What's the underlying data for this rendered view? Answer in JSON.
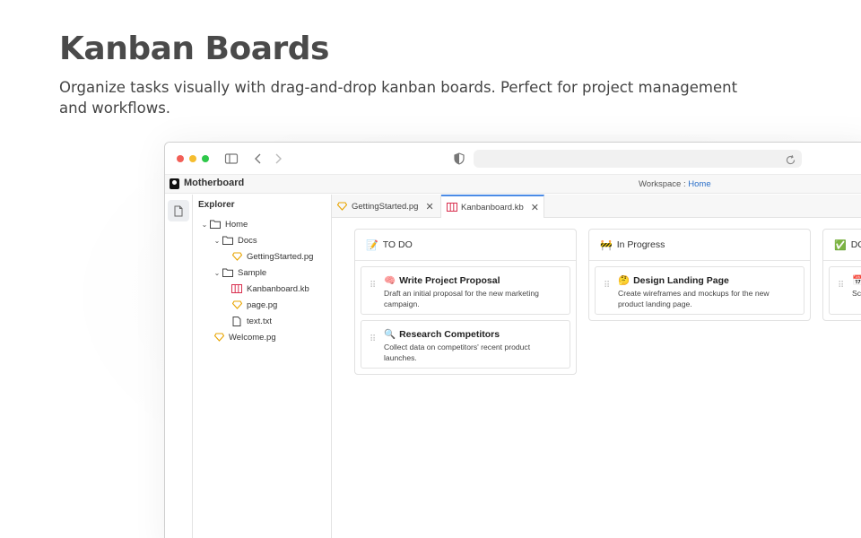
{
  "hero": {
    "title": "Kanban Boards",
    "description": "Organize tasks visually with drag-and-drop kanban boards. Perfect for project management and workflows."
  },
  "browser": {
    "url": ""
  },
  "app": {
    "name": "Motherboard",
    "workspace_label": "Workspace : ",
    "workspace_link": "Home"
  },
  "explorer": {
    "title": "Explorer",
    "items": [
      {
        "label": "Home",
        "icon": "folder-icon",
        "expanded": true
      },
      {
        "label": "Docs",
        "icon": "folder-icon",
        "expanded": true
      },
      {
        "label": "GettingStarted.pg",
        "icon": "page-file-icon"
      },
      {
        "label": "Sample",
        "icon": "folder-icon",
        "expanded": true
      },
      {
        "label": "Kanbanboard.kb",
        "icon": "kanban-file-icon"
      },
      {
        "label": "page.pg",
        "icon": "page-file-icon"
      },
      {
        "label": "text.txt",
        "icon": "text-file-icon"
      },
      {
        "label": "Welcome.pg",
        "icon": "page-file-icon"
      }
    ]
  },
  "tabs": [
    {
      "label": "GettingStarted.pg",
      "icon": "page-file-icon",
      "active": false
    },
    {
      "label": "Kanbanboard.kb",
      "icon": "kanban-file-icon",
      "active": true
    }
  ],
  "board": {
    "columns": [
      {
        "title": "TO DO",
        "emoji": "📝",
        "cards": [
          {
            "emoji": "🧠",
            "title": "Write Project Proposal",
            "description": "Draft an initial proposal for the new marketing campaign."
          },
          {
            "emoji": "🔍",
            "title": "Research Competitors",
            "description": "Collect data on competitors' recent product launches."
          }
        ]
      },
      {
        "title": "In Progress",
        "emoji": "🚧",
        "cards": [
          {
            "emoji": "🤔",
            "title": "Design Landing Page",
            "description": "Create wireframes and mockups for the new product landing page."
          }
        ]
      },
      {
        "title": "DO",
        "emoji": "✅",
        "cards": [
          {
            "emoji": "📅",
            "title": "",
            "description": "Sch pro"
          }
        ]
      }
    ]
  },
  "colors": {
    "accent_blue": "#4b8be6",
    "link_blue": "#2a6fc9",
    "close_red": "#f25f57",
    "minimize_yellow": "#f5bd2f",
    "maximize_green": "#2ec84a",
    "page_icon": "#e8a400",
    "kanban_icon": "#d9304f"
  }
}
